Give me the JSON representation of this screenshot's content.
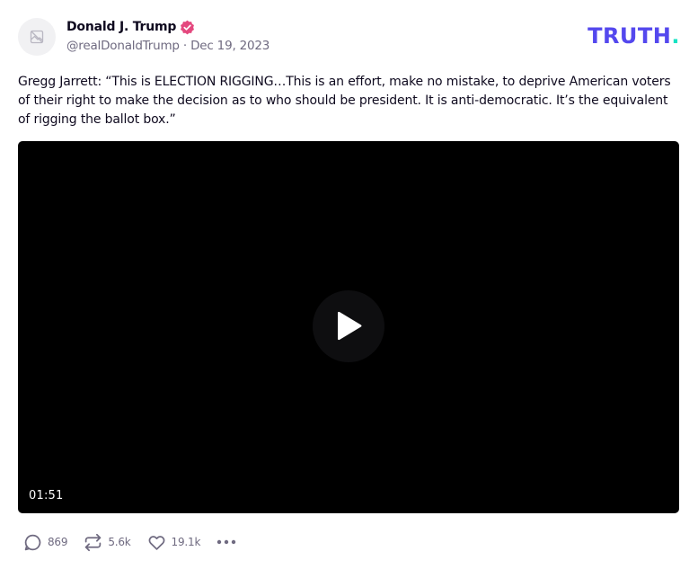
{
  "author": {
    "display_name": "Donald J. Trump",
    "handle": "@realDonaldTrump",
    "separator": "·",
    "date": "Dec 19, 2023",
    "verified_icon": "verified-badge-icon",
    "avatar_icon": "image-placeholder-icon"
  },
  "brand": {
    "logo_text": "TRUTH",
    "logo_dot": ".",
    "primary_color": "#5448ee",
    "accent_color": "#17e3c3"
  },
  "post": {
    "text": "Gregg Jarrett: “This is ELECTION RIGGING…This is an effort, make no mistake, to deprive American voters of their right to make the decision as to who should be president. It is anti-democratic. It’s the equivalent of rigging the ballot box.”"
  },
  "video": {
    "duration": "01:51",
    "play_icon": "play-icon"
  },
  "actions": {
    "replies": "869",
    "retruths": "5.6k",
    "likes": "19.1k",
    "reply_icon": "reply-icon",
    "retruth_icon": "retruth-icon",
    "like_icon": "heart-icon",
    "more_icon": "more-icon"
  },
  "colors": {
    "verified": "#e4487e",
    "text": "#0f0a1f",
    "muted": "#6f6a80"
  }
}
